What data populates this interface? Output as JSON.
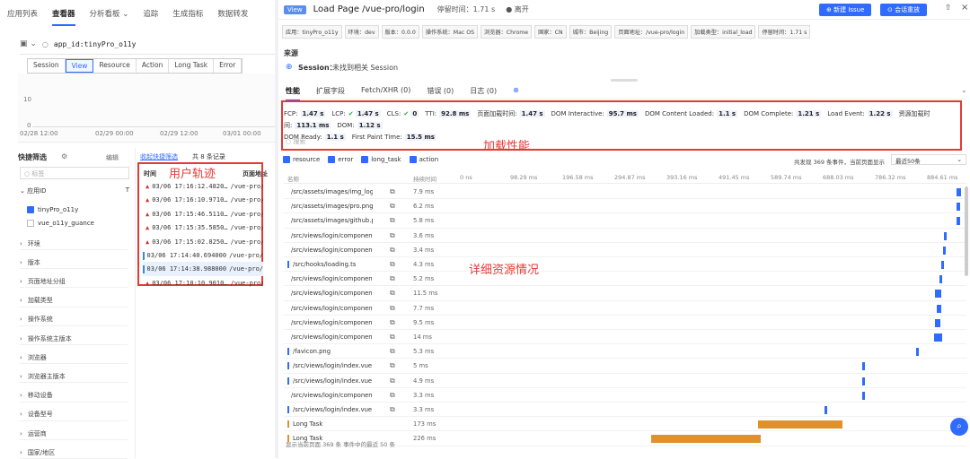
{
  "topnav": {
    "items": [
      "应用列表",
      "查看器",
      "分析看板 ⌄",
      "追踪",
      "生成指标",
      "数据转发"
    ]
  },
  "left": {
    "query": "app_id:tinyPro_o11y",
    "tabs": [
      "Session",
      "View",
      "Resource",
      "Action",
      "Long Task",
      "Error"
    ],
    "chart": {
      "y": [
        "10",
        "0"
      ],
      "x": [
        "02/28 12:00",
        "02/29 00:00",
        "02/29 12:00",
        "03/01 00:00"
      ]
    },
    "quick_title": "快捷筛选",
    "edit_label": "编辑",
    "collect_label": "收起快捷筛选",
    "records": "共 8 条记录",
    "search_placeholder": "标签",
    "appid_label": "应用ID",
    "apps": [
      "tinyPro_o11y",
      "vue_o11y_guance"
    ],
    "filters": [
      "环境",
      "版本",
      "页面地址分组",
      "加载类型",
      "操作系统",
      "操作系统主版本",
      "浏览器",
      "浏览器主版本",
      "移动设备",
      "设备型号",
      "运营商",
      "国家/地区"
    ],
    "trail_head": [
      "时间",
      "页面地址"
    ],
    "trail": [
      {
        "t": "03/06 17:16:12.4820…",
        "p": "/vue-pro/",
        "warn": true
      },
      {
        "t": "03/06 17:16:10.9710…",
        "p": "/vue-pro/",
        "warn": true
      },
      {
        "t": "03/06 17:15:46.5110…",
        "p": "/vue-pro/",
        "warn": true
      },
      {
        "t": "03/06 17:15:35.5850…",
        "p": "/vue-pro/",
        "warn": true
      },
      {
        "t": "03/06 17:15:02.8250…",
        "p": "/vue-pro/",
        "warn": true
      },
      {
        "t": "03/06 17:14:40.694000",
        "p": "/vue-pro/",
        "warn": false
      },
      {
        "t": "03/06 17:14:38.988000",
        "p": "/vue-pro/",
        "warn": false
      },
      {
        "t": "03/06 17:10:10.9010…",
        "p": "/vue-pro/",
        "warn": true
      }
    ],
    "trail_label": "用户轨迹"
  },
  "detail": {
    "badge": "View",
    "title": "Load Page /vue-pro/login",
    "stay": "停留时间：1.71 s",
    "status": "离开",
    "btn_issue": "新建 Issue",
    "btn_replay": "会话重放",
    "tags": [
      "应用：tinyPro_o11y",
      "环境：dev",
      "版本：0.0.0",
      "操作系统：Mac OS",
      "浏览器：Chrome",
      "国家：CN",
      "城市：Beijing",
      "页面地址：/vue-pro/login",
      "加载类型：initial_load",
      "停留时间：1.71 s"
    ],
    "source_title": "来源",
    "session_label": "Session：",
    "session_value": "未找到相关 Session",
    "tabs": [
      "性能",
      "扩展字段",
      "Fetch/XHR (0)",
      "错误 (0)",
      "日志 (0)"
    ],
    "metrics_line1": [
      [
        "FCP:",
        "1.47 s"
      ],
      [
        "LCP:",
        "1.47 s"
      ],
      [
        "CLS:",
        "0"
      ],
      [
        "TTI:",
        "92.8 ms"
      ],
      [
        "页面加载时间:",
        "1.47 s"
      ],
      [
        "DOM Interactive:",
        "95.7 ms"
      ],
      [
        "DOM Content Loaded:",
        "1.1 s"
      ],
      [
        "DOM Complete:",
        "1.21 s"
      ],
      [
        "Load Event:",
        "1.22 s"
      ],
      [
        "资源加载时间:",
        "113.1 ms"
      ],
      [
        "DOM:",
        "1.12 s"
      ]
    ],
    "metrics_line2": [
      [
        "DOM Ready:",
        "1.1 s"
      ],
      [
        "First Paint Time:",
        "15.5 ms"
      ]
    ],
    "search_placeholder": "搜索",
    "perf_label": "加载性能",
    "types": [
      "resource",
      "error",
      "long_task",
      "action"
    ],
    "found": "共发现 369 条事件，当前页面显示",
    "select": "最近50条",
    "res_head": [
      "名称",
      "持续时间",
      "0 ns",
      "98.29 ms",
      "196.58 ms",
      "294.87 ms",
      "393.16 ms",
      "491.45 ms",
      "589.74 ms",
      "688.03 ms",
      "786.32 ms",
      "884.61 ms"
    ],
    "resources": [
      {
        "n": "/src/assets/images/img_log…",
        "d": "7.9 ms",
        "s": 0.985,
        "w": 0.008,
        "type": "r"
      },
      {
        "n": "/src/assets/images/pro.png",
        "d": "6.2 ms",
        "s": 0.985,
        "w": 0.007,
        "type": "r"
      },
      {
        "n": "/src/assets/images/github.png",
        "d": "5.8 ms",
        "s": 0.985,
        "w": 0.006,
        "type": "r"
      },
      {
        "n": "/src/views/login/components…",
        "d": "3.6 ms",
        "s": 0.96,
        "w": 0.004,
        "type": "r"
      },
      {
        "n": "/src/views/login/components…",
        "d": "3.4 ms",
        "s": 0.958,
        "w": 0.004,
        "type": "r"
      },
      {
        "n": "/src/hooks/loading.ts",
        "d": "4.3 ms",
        "s": 0.955,
        "w": 0.005,
        "type": "r"
      },
      {
        "n": "/src/views/login/components…",
        "d": "5.2 ms",
        "s": 0.95,
        "w": 0.006,
        "type": "r"
      },
      {
        "n": "/src/views/login/components…",
        "d": "11.5 ms",
        "s": 0.942,
        "w": 0.013,
        "type": "r"
      },
      {
        "n": "/src/views/login/components…",
        "d": "7.7 ms",
        "s": 0.945,
        "w": 0.009,
        "type": "r"
      },
      {
        "n": "/src/views/login/components…",
        "d": "9.5 ms",
        "s": 0.942,
        "w": 0.011,
        "type": "r"
      },
      {
        "n": "/src/views/login/components…",
        "d": "14 ms",
        "s": 0.94,
        "w": 0.016,
        "type": "r"
      },
      {
        "n": "/favicon.png",
        "d": "5.3 ms",
        "s": 0.905,
        "w": 0.004,
        "type": "r"
      },
      {
        "n": "/src/views/login/index.vue",
        "d": "5 ms",
        "s": 0.8,
        "w": 0.004,
        "type": "r"
      },
      {
        "n": "/src/views/login/index.vue",
        "d": "4.9 ms",
        "s": 0.8,
        "w": 0.004,
        "type": "r"
      },
      {
        "n": "/src/views/login/components…",
        "d": "3.3 ms",
        "s": 0.8,
        "w": 0.004,
        "type": "r"
      },
      {
        "n": "/src/views/login/index.vue",
        "d": "3.3 ms",
        "s": 0.725,
        "w": 0.004,
        "type": "r"
      },
      {
        "n": "Long Task",
        "d": "173 ms",
        "s": 0.595,
        "w": 0.165,
        "type": "l"
      },
      {
        "n": "Long Task",
        "d": "226 ms",
        "s": 0.385,
        "w": 0.215,
        "type": "l"
      }
    ],
    "res_label": "详细资源情况",
    "footer": "显示当前页面 369 条 事件中的最近 50 条"
  }
}
